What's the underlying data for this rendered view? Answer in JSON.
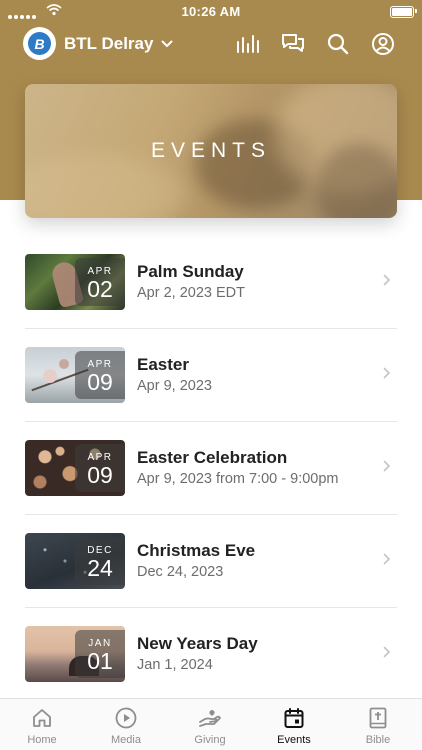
{
  "status_bar": {
    "time": "10:26 AM"
  },
  "header": {
    "church_name": "BTL Delray",
    "logo_letter": "B"
  },
  "banner": {
    "title": "EVENTS"
  },
  "events": [
    {
      "month": "APR",
      "day": "02",
      "title": "Palm Sunday",
      "subtitle": "Apr 2, 2023 EDT"
    },
    {
      "month": "APR",
      "day": "09",
      "title": "Easter",
      "subtitle": "Apr 9, 2023"
    },
    {
      "month": "APR",
      "day": "09",
      "title": "Easter Celebration",
      "subtitle": "Apr 9, 2023 from 7:00 - 9:00pm"
    },
    {
      "month": "DEC",
      "day": "24",
      "title": "Christmas Eve",
      "subtitle": "Dec 24, 2023"
    },
    {
      "month": "JAN",
      "day": "01",
      "title": "New Years Day",
      "subtitle": "Jan 1, 2024"
    }
  ],
  "tabs": [
    {
      "label": "Home",
      "icon": "home-icon"
    },
    {
      "label": "Media",
      "icon": "play-icon"
    },
    {
      "label": "Giving",
      "icon": "giving-hand-icon"
    },
    {
      "label": "Events",
      "icon": "calendar-icon",
      "active": true
    },
    {
      "label": "Bible",
      "icon": "bible-icon"
    }
  ],
  "colors": {
    "header_gold": "#a98a4e",
    "active_tab": "#111111",
    "inactive_tab": "#8e8e8e"
  }
}
